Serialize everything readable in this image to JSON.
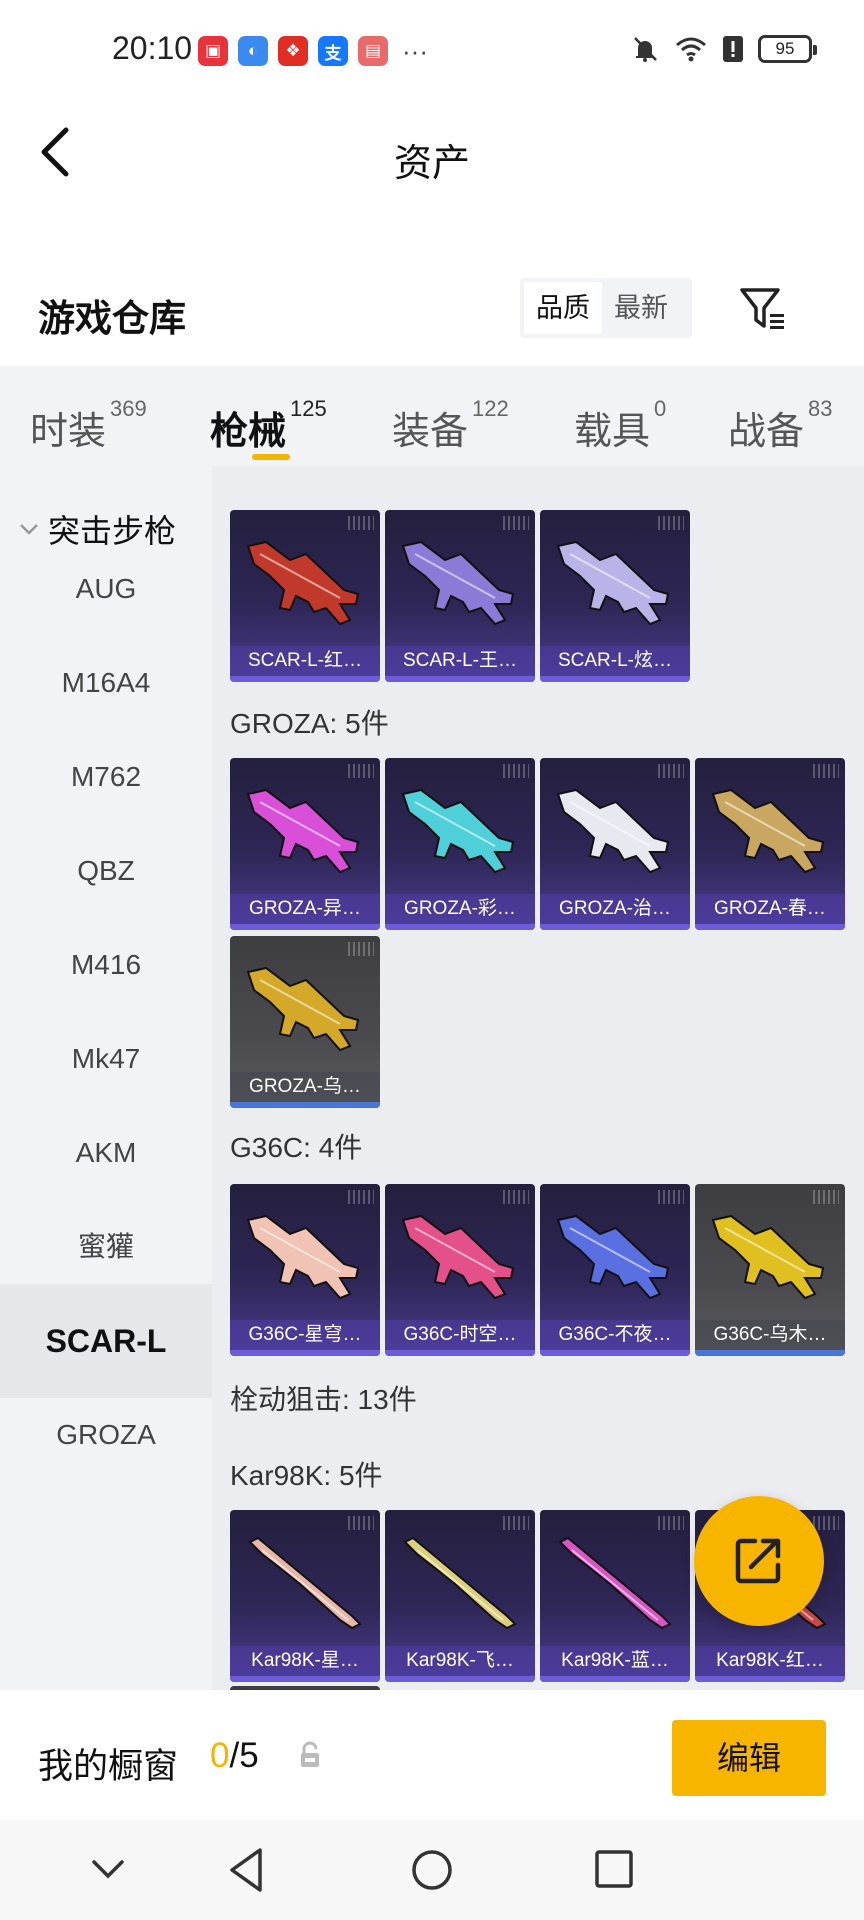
{
  "status_bar": {
    "time": "20:10",
    "app_icons": [
      {
        "name": "huawei-mall-icon",
        "color": "#e8333c",
        "glyph": "▣"
      },
      {
        "name": "browser-icon",
        "color": "#3a8af0",
        "glyph": "◐"
      },
      {
        "name": "pinduoduo-icon",
        "color": "#e02e24",
        "glyph": "❖"
      },
      {
        "name": "alipay-icon",
        "color": "#1677ff",
        "glyph": "支"
      },
      {
        "name": "gift-icon",
        "color": "#e86a6a",
        "glyph": "▤"
      }
    ],
    "more": "···",
    "battery": "95"
  },
  "header": {
    "title": "资产"
  },
  "section": {
    "title": "游戏仓库",
    "sort_options": [
      {
        "label": "品质",
        "active": true
      },
      {
        "label": "最新",
        "active": false
      }
    ]
  },
  "tabs": [
    {
      "label": "时装",
      "count": "369"
    },
    {
      "label": "枪械",
      "count": "125",
      "active": true
    },
    {
      "label": "装备",
      "count": "122"
    },
    {
      "label": "载具",
      "count": "0"
    },
    {
      "label": "战备",
      "count": "83"
    }
  ],
  "sidebar": {
    "group": "突击步枪",
    "items": [
      "AUG",
      "M16A4",
      "M762",
      "QBZ",
      "M416",
      "Mk47",
      "AKM",
      "蜜獾",
      "SCAR-L",
      "GROZA"
    ],
    "active_index": 8
  },
  "content": {
    "groups": [
      {
        "label": "",
        "cards": [
          {
            "name": "SCAR-L-红…",
            "color": "#c0392b",
            "style": "purple"
          },
          {
            "name": "SCAR-L-王…",
            "color": "#8c7bd6",
            "style": "purple"
          },
          {
            "name": "SCAR-L-炫…",
            "color": "#b9b4e8",
            "style": "purple"
          }
        ]
      },
      {
        "label": "GROZA: 5件",
        "cards": [
          {
            "name": "GROZA-异…",
            "color": "#d84fd8",
            "style": "purple"
          },
          {
            "name": "GROZA-彩…",
            "color": "#4fd0d8",
            "style": "purple"
          },
          {
            "name": "GROZA-治…",
            "color": "#e8e8f0",
            "style": "purple"
          },
          {
            "name": "GROZA-春…",
            "color": "#c9a760",
            "style": "purple"
          },
          {
            "name": "GROZA-乌…",
            "color": "#d4a92a",
            "style": "gray"
          }
        ]
      },
      {
        "label": "G36C: 4件",
        "cards": [
          {
            "name": "G36C-星穹…",
            "color": "#f0c3b4",
            "style": "purple"
          },
          {
            "name": "G36C-时空…",
            "color": "#e3508a",
            "style": "purple"
          },
          {
            "name": "G36C-不夜…",
            "color": "#5a6fe0",
            "style": "purple"
          },
          {
            "name": "G36C-乌木…",
            "color": "#e0c020",
            "style": "gray"
          }
        ]
      },
      {
        "label": "栓动狙击: 13件",
        "cards": []
      },
      {
        "label": "Kar98K: 5件",
        "cards": [
          {
            "name": "Kar98K-星…",
            "color": "#e6b7a8",
            "style": "purple"
          },
          {
            "name": "Kar98K-飞…",
            "color": "#dccf7a",
            "style": "purple"
          },
          {
            "name": "Kar98K-蓝…",
            "color": "#d855c6",
            "style": "purple"
          },
          {
            "name": "Kar98K-红…",
            "color": "#c94848",
            "style": "purple"
          }
        ]
      }
    ]
  },
  "bottom": {
    "label": "我的橱窗",
    "current": "0",
    "total": "/5",
    "edit_label": "编辑"
  },
  "colors": {
    "accent": "#f7b500",
    "card_purple": "#2e2656",
    "card_gray": "#4a4a4f"
  }
}
